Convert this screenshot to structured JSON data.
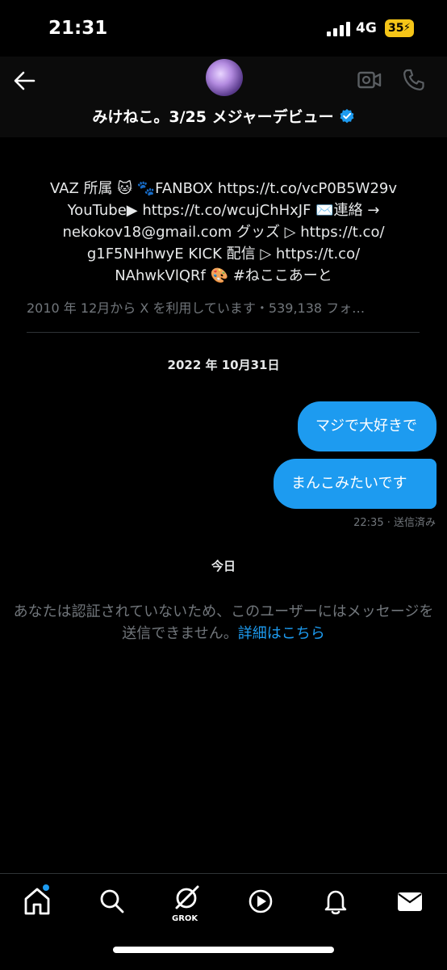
{
  "status": {
    "time": "21:31",
    "network": "4G",
    "battery": "35"
  },
  "header": {
    "title": "みけねこ。3/25 メジャーデビュー",
    "icons": [
      "back-arrow-icon",
      "avatar",
      "verified-badge-icon",
      "video-call-icon",
      "phone-icon"
    ]
  },
  "profile": {
    "bio_lines": [
      "VAZ 所属 🐱 🐾FANBOX https://t.co/vcP0B5W29v",
      "YouTube▶ https://t.co/wcujChHxJF ✉️連絡 →",
      "nekokov18@gmail.com グッズ ▷ https://t.co/",
      "g1F5NHhwyE KICK 配信 ▷ https://t.co/",
      "NAhwkVlQRf 🎨 #ねここあーと"
    ],
    "joined": "2010 年 12月から X を利用しています・539,138 フォ…"
  },
  "conversation": {
    "date_separator": "2022 年 10月31日",
    "messages": [
      {
        "text": "マジで大好きです"
      },
      {
        "text": "まんこみたいです"
      }
    ],
    "meta": "22:35 · 送信済み",
    "today": "今日",
    "notice": "あなたは認証されていないため、このユーザーにはメッセージを送信できません。",
    "notice_link": "詳細はこちら"
  },
  "tabbar": {
    "grok_label": "GROK",
    "items": [
      "home-icon",
      "search-icon",
      "grok-icon",
      "video-play-icon",
      "notifications-bell-icon",
      "messages-mail-icon"
    ]
  },
  "colors": {
    "accent": "#1d9bf0",
    "background": "#000000",
    "muted": "#71767b",
    "battery": "#f5c518"
  }
}
